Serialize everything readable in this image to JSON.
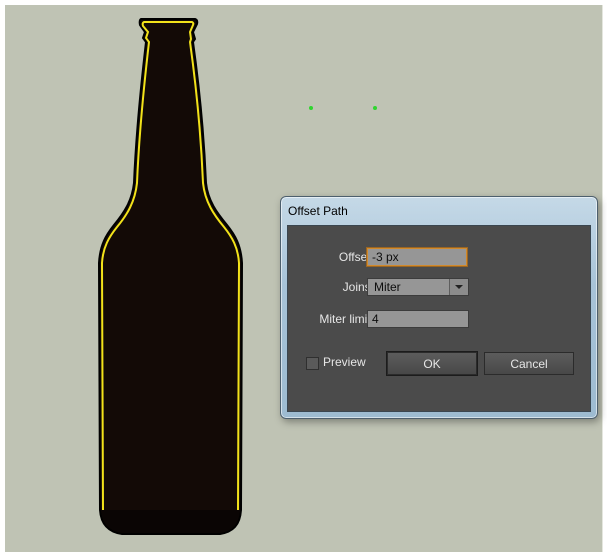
{
  "dialog": {
    "title": "Offset Path",
    "offset": {
      "label": "Offset:",
      "value": "-3 px"
    },
    "joins": {
      "label": "Joins:",
      "value": "Miter"
    },
    "miter_limit": {
      "label": "Miter limit:",
      "value": "4"
    },
    "preview": {
      "label": "Preview",
      "checked": false
    },
    "ok_label": "OK",
    "cancel_label": "Cancel"
  },
  "colors": {
    "canvas": "#bfc3b4",
    "bottle_fill": "#130a06",
    "selection_outline": "#f2e21a",
    "anchor_points": "#2fd52f"
  },
  "icons": [
    "chevron-down-icon"
  ]
}
